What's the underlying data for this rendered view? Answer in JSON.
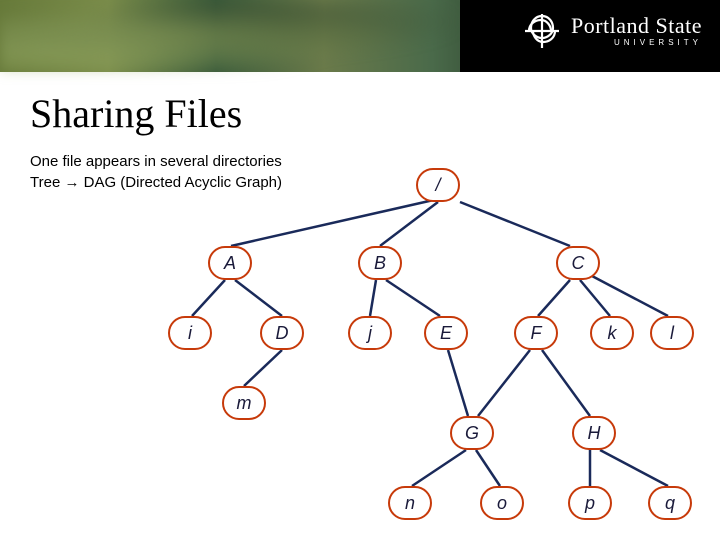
{
  "logo": {
    "main": "Portland State",
    "sub": "UNIVERSITY"
  },
  "title": "Sharing Files",
  "subtitle_line1": "One file appears in several directories",
  "subtitle_line2": "Tree → DAG (Directed Acyclic Graph)",
  "nodes": {
    "root": "/",
    "A": "A",
    "B": "B",
    "C": "C",
    "i": "i",
    "D": "D",
    "j": "j",
    "E": "E",
    "F": "F",
    "k": "k",
    "l": "l",
    "m": "m",
    "G": "G",
    "H": "H",
    "n": "n",
    "o": "o",
    "p": "p",
    "q": "q"
  },
  "diagram": {
    "description": "Directed acyclic graph showing file system hierarchy where one file (or subtree) can appear under multiple directories.",
    "edges": [
      [
        "/",
        "A"
      ],
      [
        "/",
        "B"
      ],
      [
        "/",
        "C"
      ],
      [
        "A",
        "i"
      ],
      [
        "A",
        "D"
      ],
      [
        "B",
        "j"
      ],
      [
        "B",
        "E"
      ],
      [
        "C",
        "F"
      ],
      [
        "C",
        "k"
      ],
      [
        "C",
        "l"
      ],
      [
        "D",
        "m"
      ],
      [
        "E",
        "G"
      ],
      [
        "F",
        "G"
      ],
      [
        "F",
        "H"
      ],
      [
        "G",
        "n"
      ],
      [
        "G",
        "o"
      ],
      [
        "H",
        "p"
      ],
      [
        "H",
        "q"
      ]
    ]
  }
}
